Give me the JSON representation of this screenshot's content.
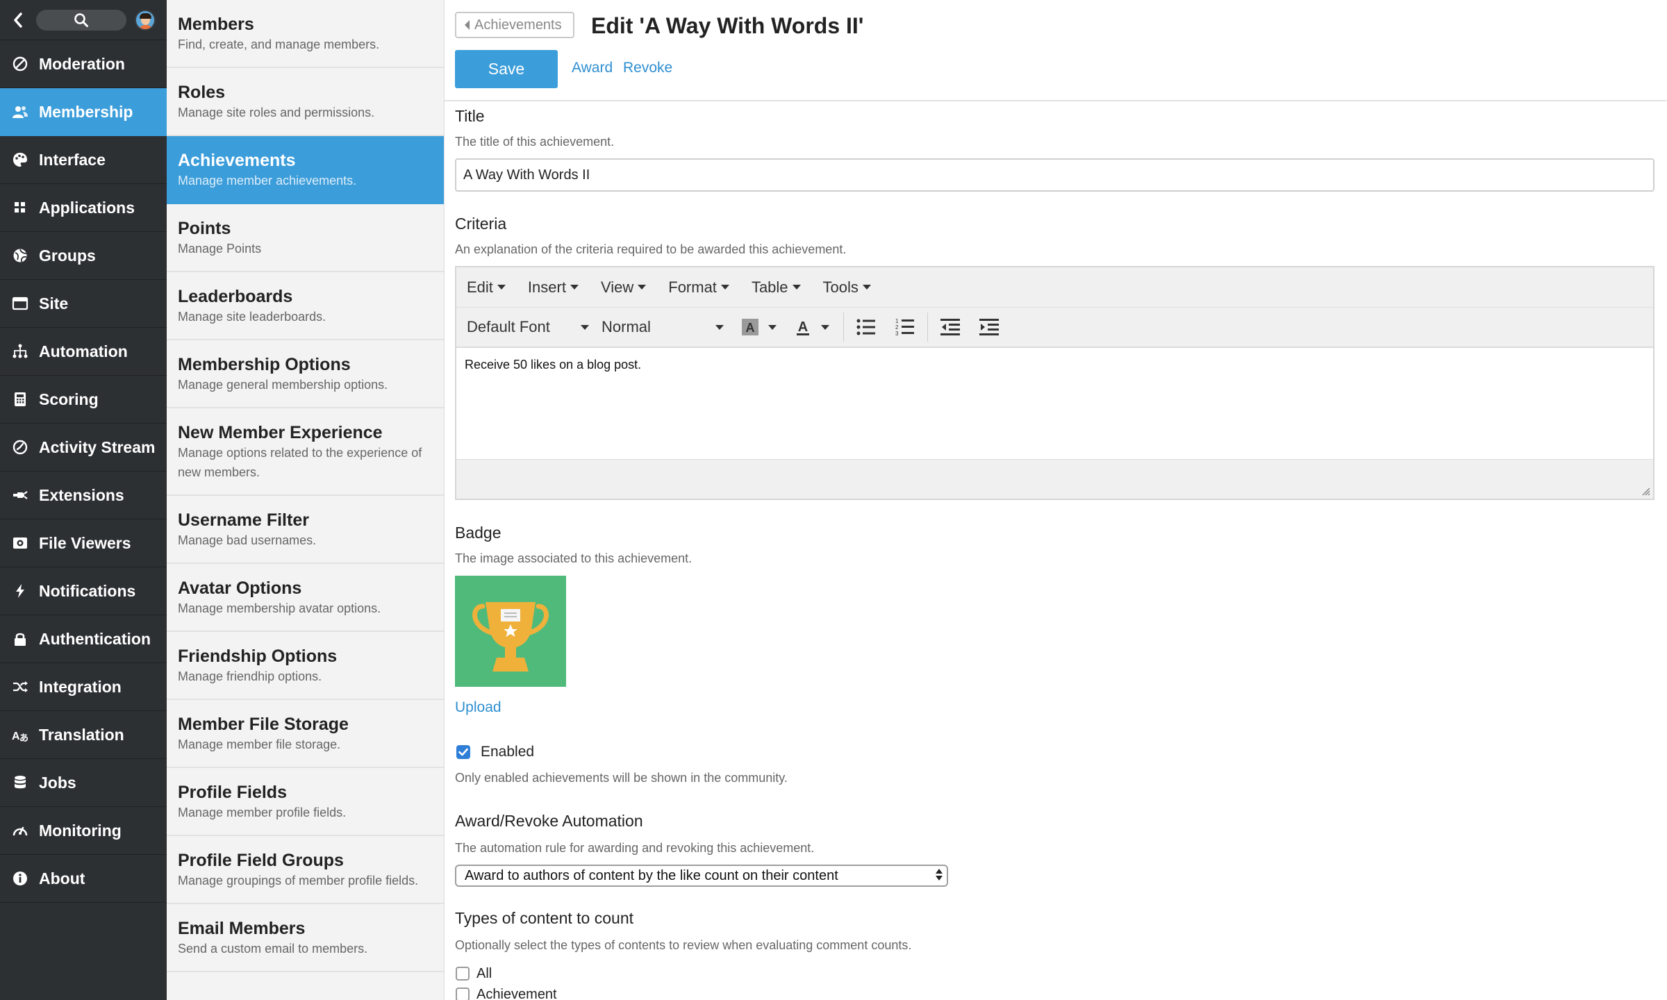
{
  "nav": {
    "items": [
      {
        "label": "Moderation",
        "icon": "moderation-icon",
        "active": false
      },
      {
        "label": "Membership",
        "icon": "membership-icon",
        "active": true
      },
      {
        "label": "Interface",
        "icon": "palette-icon",
        "active": false
      },
      {
        "label": "Applications",
        "icon": "grid-icon",
        "active": false
      },
      {
        "label": "Groups",
        "icon": "groups-icon",
        "active": false
      },
      {
        "label": "Site",
        "icon": "window-icon",
        "active": false
      },
      {
        "label": "Automation",
        "icon": "sitemap-icon",
        "active": false
      },
      {
        "label": "Scoring",
        "icon": "calculator-icon",
        "active": false
      },
      {
        "label": "Activity Stream",
        "icon": "clock-icon",
        "active": false
      },
      {
        "label": "Extensions",
        "icon": "plug-icon",
        "active": false
      },
      {
        "label": "File Viewers",
        "icon": "camera-icon",
        "active": false
      },
      {
        "label": "Notifications",
        "icon": "bolt-icon",
        "active": false
      },
      {
        "label": "Authentication",
        "icon": "lock-icon",
        "active": false
      },
      {
        "label": "Integration",
        "icon": "shuffle-icon",
        "active": false
      },
      {
        "label": "Translation",
        "icon": "translate-icon",
        "active": false
      },
      {
        "label": "Jobs",
        "icon": "database-icon",
        "active": false
      },
      {
        "label": "Monitoring",
        "icon": "gauge-icon",
        "active": false
      },
      {
        "label": "About",
        "icon": "info-icon",
        "active": false
      }
    ]
  },
  "sub": {
    "items": [
      {
        "title": "Members",
        "desc": "Find, create, and manage members.",
        "active": false
      },
      {
        "title": "Roles",
        "desc": "Manage site roles and permissions.",
        "active": false
      },
      {
        "title": "Achievements",
        "desc": "Manage member achievements.",
        "active": true
      },
      {
        "title": "Points",
        "desc": "Manage Points",
        "active": false
      },
      {
        "title": "Leaderboards",
        "desc": "Manage site leaderboards.",
        "active": false
      },
      {
        "title": "Membership Options",
        "desc": "Manage general membership options.",
        "active": false
      },
      {
        "title": "New Member Experience",
        "desc": "Manage options related to the experience of new members.",
        "active": false
      },
      {
        "title": "Username Filter",
        "desc": "Manage bad usernames.",
        "active": false
      },
      {
        "title": "Avatar Options",
        "desc": "Manage membership avatar options.",
        "active": false
      },
      {
        "title": "Friendship Options",
        "desc": "Manage friendhip options.",
        "active": false
      },
      {
        "title": "Member File Storage",
        "desc": "Manage member file storage.",
        "active": false
      },
      {
        "title": "Profile Fields",
        "desc": "Manage member profile fields.",
        "active": false
      },
      {
        "title": "Profile Field Groups",
        "desc": "Manage groupings of member profile fields.",
        "active": false
      },
      {
        "title": "Email Members",
        "desc": "Send a custom email to members.",
        "active": false
      }
    ]
  },
  "header": {
    "breadcrumb": "Achievements",
    "title": "Edit 'A Way With Words II'",
    "save_label": "Save",
    "award_label": "Award",
    "revoke_label": "Revoke"
  },
  "form": {
    "title_label": "Title",
    "title_desc": "The title of this achievement.",
    "title_value": "A Way With Words II",
    "criteria_label": "Criteria",
    "criteria_desc": "An explanation of the criteria required to be awarded this achievement.",
    "editor": {
      "menus": [
        "Edit",
        "Insert",
        "View",
        "Format",
        "Table",
        "Tools"
      ],
      "font_family": "Default Font",
      "font_size": "Normal",
      "content": "Receive 50 likes on a blog post."
    },
    "badge_label": "Badge",
    "badge_desc": "The image associated to this achievement.",
    "badge_icon": "trophy-icon",
    "upload_label": "Upload",
    "enabled_label": "Enabled",
    "enabled_checked": true,
    "enabled_desc": "Only enabled achievements will be shown in the community.",
    "automation_label": "Award/Revoke Automation",
    "automation_desc": "The automation rule for awarding and revoking this achievement.",
    "automation_value": "Award to authors of content by the like count on their content",
    "types_label": "Types of content to count",
    "types_desc": "Optionally select the types of contents to review when evaluating comment counts.",
    "types": [
      {
        "label": "All",
        "checked": false
      },
      {
        "label": "Achievement",
        "checked": false
      }
    ]
  },
  "colors": {
    "accent": "#3b9dda",
    "nav_bg": "#2d3033",
    "link": "#2f8fd1",
    "badge_bg": "#4fba7a",
    "trophy": "#f0b13b"
  }
}
